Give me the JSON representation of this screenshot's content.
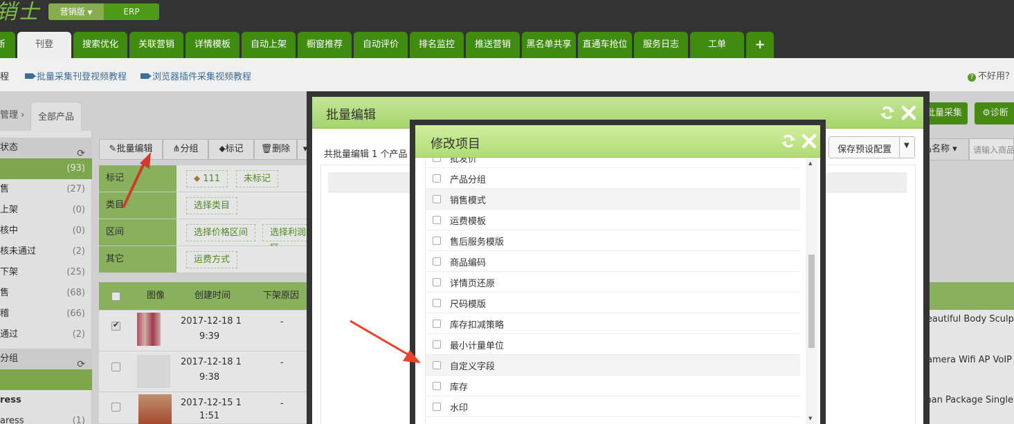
{
  "app": {
    "logo_text": "销士"
  },
  "top": {
    "version_label": "营销版",
    "erp_label": "ERP",
    "nav_tabs": [
      {
        "label": "断"
      },
      {
        "label": "刊登",
        "active": true
      },
      {
        "label": "搜索优化"
      },
      {
        "label": "关联营销"
      },
      {
        "label": "详情模板"
      },
      {
        "label": "自动上架"
      },
      {
        "label": "橱窗推荐"
      },
      {
        "label": "自动评价"
      },
      {
        "label": "排名监控"
      },
      {
        "label": "推送营销"
      },
      {
        "label": "黑名单共享"
      },
      {
        "label": "直通车抢位"
      },
      {
        "label": "服务日志"
      },
      {
        "label": "工单"
      },
      {
        "label": "+"
      }
    ]
  },
  "subbar": {
    "link0": "程",
    "link1": "批量采集刊登视频教程",
    "link2": "浏览器插件采集视频教程",
    "help": "不好用？"
  },
  "page": {
    "crumb": "管理",
    "all_tab": "全部产品",
    "right_btn1": "批量采集",
    "right_btn2": "诊断",
    "sort_label": "品名称",
    "search_placeholder": "请输入商品"
  },
  "left_panel": {
    "status_head": "状态",
    "rows": [
      {
        "label": "",
        "count": "(93)"
      },
      {
        "label": "售",
        "count": "(27)"
      },
      {
        "label": "上架",
        "count": "(0)"
      },
      {
        "label": "核中",
        "count": "(0)"
      },
      {
        "label": "核未通过",
        "count": "(2)"
      },
      {
        "label": "下架",
        "count": "(25)"
      },
      {
        "label": "售",
        "count": "(68)"
      },
      {
        "label": "稽",
        "count": "(66)"
      },
      {
        "label": "通过",
        "count": "(2)"
      }
    ],
    "group_head": "分组",
    "group_row1": "ress",
    "group_row2": "aress",
    "group_row2_count": "(1)"
  },
  "toolbar": {
    "batch_edit": "批量编辑",
    "group": "分组",
    "mark": "标记",
    "delete": "删除"
  },
  "filters": {
    "mark_label": "标记",
    "mark_tag": "111",
    "mark_none": "未标记",
    "category_label": "类目",
    "category_btn": "选择类目",
    "range_label": "区间",
    "price_btn": "选择价格区间",
    "profit_btn": "选择利润区",
    "other_label": "其它",
    "shipping_btn": "运费方式"
  },
  "table": {
    "headers": {
      "image": "图像",
      "created": "创建时间",
      "off_reason": "下架原因"
    },
    "rows": [
      {
        "date": "2017-12-18 1",
        "time": "9:39",
        "reason": "-",
        "title": "Beautiful Body Sculp",
        "checked": true
      },
      {
        "date": "2017-12-18 1",
        "time": "9:38",
        "reason": "-",
        "title": "Camera Wifi AP VoIP",
        "checked": false
      },
      {
        "date": "2017-12-15 1",
        "time": "1:51",
        "reason": "-",
        "title": "man Package Single",
        "checked": false
      }
    ]
  },
  "modal1": {
    "title": "批量编辑",
    "count_text": "共批量编辑 1 个产品",
    "save_preset": "保存预设配置"
  },
  "modal2": {
    "title": "修改项目",
    "items": [
      "批发价",
      "产品分组",
      "销售模式",
      "运费模板",
      "售后服务模版",
      "商品编码",
      "详情页还原",
      "尺码模版",
      "库存扣减策略",
      "最小计量单位",
      "自定义字段",
      "库存",
      "水印"
    ]
  },
  "colors": {
    "brand_green": "#4e9a17",
    "dark_bar": "#333333",
    "header_green": "#a5d46b",
    "arrow_red": "#e8432d"
  }
}
